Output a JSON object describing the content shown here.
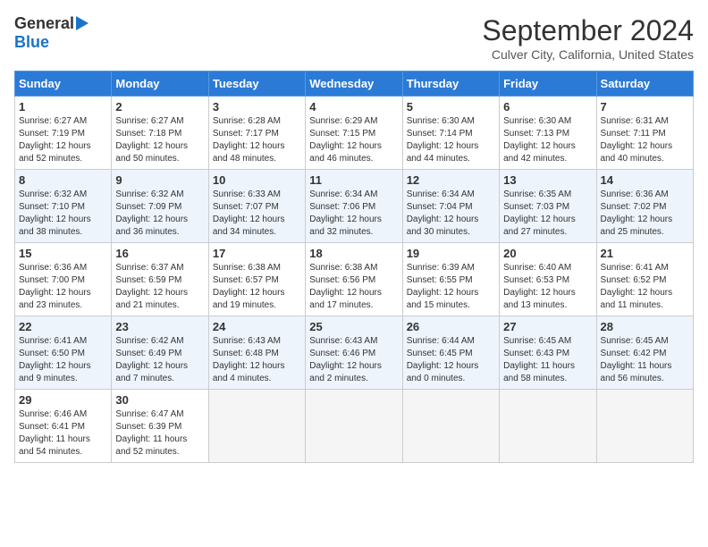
{
  "header": {
    "logo_line1": "General",
    "logo_line2": "Blue",
    "title": "September 2024",
    "subtitle": "Culver City, California, United States"
  },
  "calendar": {
    "days_of_week": [
      "Sunday",
      "Monday",
      "Tuesday",
      "Wednesday",
      "Thursday",
      "Friday",
      "Saturday"
    ],
    "weeks": [
      [
        {
          "day": "1",
          "info": "Sunrise: 6:27 AM\nSunset: 7:19 PM\nDaylight: 12 hours\nand 52 minutes."
        },
        {
          "day": "2",
          "info": "Sunrise: 6:27 AM\nSunset: 7:18 PM\nDaylight: 12 hours\nand 50 minutes."
        },
        {
          "day": "3",
          "info": "Sunrise: 6:28 AM\nSunset: 7:17 PM\nDaylight: 12 hours\nand 48 minutes."
        },
        {
          "day": "4",
          "info": "Sunrise: 6:29 AM\nSunset: 7:15 PM\nDaylight: 12 hours\nand 46 minutes."
        },
        {
          "day": "5",
          "info": "Sunrise: 6:30 AM\nSunset: 7:14 PM\nDaylight: 12 hours\nand 44 minutes."
        },
        {
          "day": "6",
          "info": "Sunrise: 6:30 AM\nSunset: 7:13 PM\nDaylight: 12 hours\nand 42 minutes."
        },
        {
          "day": "7",
          "info": "Sunrise: 6:31 AM\nSunset: 7:11 PM\nDaylight: 12 hours\nand 40 minutes."
        }
      ],
      [
        {
          "day": "8",
          "info": "Sunrise: 6:32 AM\nSunset: 7:10 PM\nDaylight: 12 hours\nand 38 minutes."
        },
        {
          "day": "9",
          "info": "Sunrise: 6:32 AM\nSunset: 7:09 PM\nDaylight: 12 hours\nand 36 minutes."
        },
        {
          "day": "10",
          "info": "Sunrise: 6:33 AM\nSunset: 7:07 PM\nDaylight: 12 hours\nand 34 minutes."
        },
        {
          "day": "11",
          "info": "Sunrise: 6:34 AM\nSunset: 7:06 PM\nDaylight: 12 hours\nand 32 minutes."
        },
        {
          "day": "12",
          "info": "Sunrise: 6:34 AM\nSunset: 7:04 PM\nDaylight: 12 hours\nand 30 minutes."
        },
        {
          "day": "13",
          "info": "Sunrise: 6:35 AM\nSunset: 7:03 PM\nDaylight: 12 hours\nand 27 minutes."
        },
        {
          "day": "14",
          "info": "Sunrise: 6:36 AM\nSunset: 7:02 PM\nDaylight: 12 hours\nand 25 minutes."
        }
      ],
      [
        {
          "day": "15",
          "info": "Sunrise: 6:36 AM\nSunset: 7:00 PM\nDaylight: 12 hours\nand 23 minutes."
        },
        {
          "day": "16",
          "info": "Sunrise: 6:37 AM\nSunset: 6:59 PM\nDaylight: 12 hours\nand 21 minutes."
        },
        {
          "day": "17",
          "info": "Sunrise: 6:38 AM\nSunset: 6:57 PM\nDaylight: 12 hours\nand 19 minutes."
        },
        {
          "day": "18",
          "info": "Sunrise: 6:38 AM\nSunset: 6:56 PM\nDaylight: 12 hours\nand 17 minutes."
        },
        {
          "day": "19",
          "info": "Sunrise: 6:39 AM\nSunset: 6:55 PM\nDaylight: 12 hours\nand 15 minutes."
        },
        {
          "day": "20",
          "info": "Sunrise: 6:40 AM\nSunset: 6:53 PM\nDaylight: 12 hours\nand 13 minutes."
        },
        {
          "day": "21",
          "info": "Sunrise: 6:41 AM\nSunset: 6:52 PM\nDaylight: 12 hours\nand 11 minutes."
        }
      ],
      [
        {
          "day": "22",
          "info": "Sunrise: 6:41 AM\nSunset: 6:50 PM\nDaylight: 12 hours\nand 9 minutes."
        },
        {
          "day": "23",
          "info": "Sunrise: 6:42 AM\nSunset: 6:49 PM\nDaylight: 12 hours\nand 7 minutes."
        },
        {
          "day": "24",
          "info": "Sunrise: 6:43 AM\nSunset: 6:48 PM\nDaylight: 12 hours\nand 4 minutes."
        },
        {
          "day": "25",
          "info": "Sunrise: 6:43 AM\nSunset: 6:46 PM\nDaylight: 12 hours\nand 2 minutes."
        },
        {
          "day": "26",
          "info": "Sunrise: 6:44 AM\nSunset: 6:45 PM\nDaylight: 12 hours\nand 0 minutes."
        },
        {
          "day": "27",
          "info": "Sunrise: 6:45 AM\nSunset: 6:43 PM\nDaylight: 11 hours\nand 58 minutes."
        },
        {
          "day": "28",
          "info": "Sunrise: 6:45 AM\nSunset: 6:42 PM\nDaylight: 11 hours\nand 56 minutes."
        }
      ],
      [
        {
          "day": "29",
          "info": "Sunrise: 6:46 AM\nSunset: 6:41 PM\nDaylight: 11 hours\nand 54 minutes."
        },
        {
          "day": "30",
          "info": "Sunrise: 6:47 AM\nSunset: 6:39 PM\nDaylight: 11 hours\nand 52 minutes."
        },
        {
          "day": "",
          "info": ""
        },
        {
          "day": "",
          "info": ""
        },
        {
          "day": "",
          "info": ""
        },
        {
          "day": "",
          "info": ""
        },
        {
          "day": "",
          "info": ""
        }
      ]
    ]
  }
}
